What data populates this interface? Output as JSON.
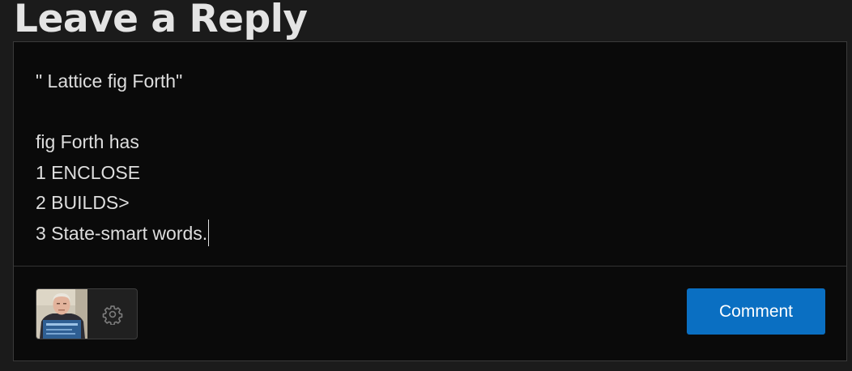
{
  "heading": "Leave a Reply",
  "comment": {
    "lines": [
      "\" Lattice fig Forth\"",
      "",
      "fig Forth has",
      "1 ENCLOSE",
      "2 BUILDS>",
      "3 State-smart words."
    ]
  },
  "identity": {
    "avatar_icon": "user-photo",
    "settings_icon": "gear-icon"
  },
  "actions": {
    "submit_label": "Comment"
  },
  "colors": {
    "page_background": "#1b1b1b",
    "form_background": "#0a0a0a",
    "accent": "#0a6fc2",
    "text": "#dedede"
  }
}
